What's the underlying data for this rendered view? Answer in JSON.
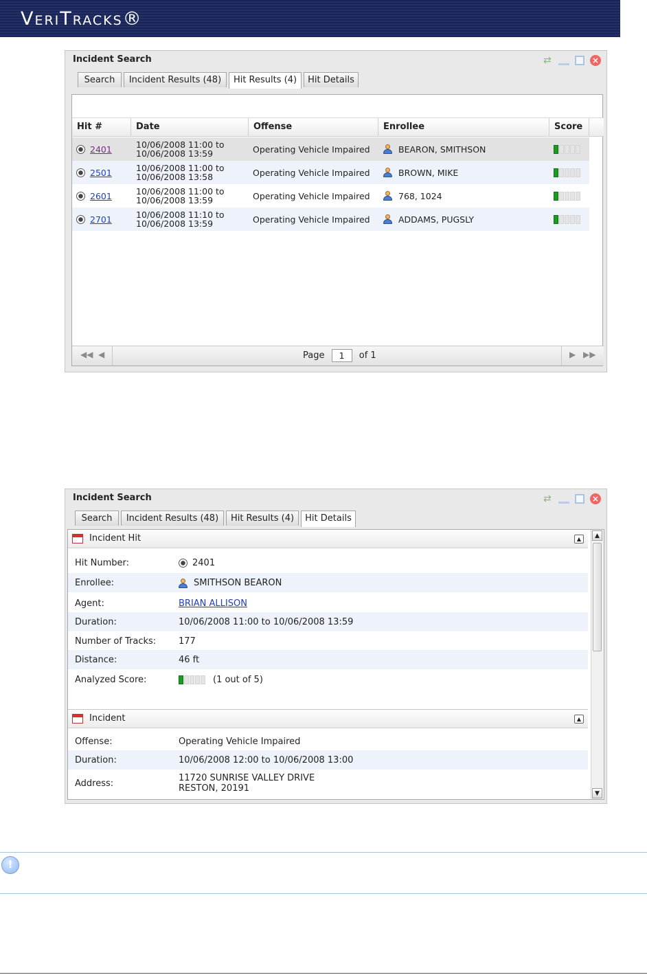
{
  "banner": {
    "logo": "VeriTracks®"
  },
  "window1": {
    "title": "Incident Search",
    "tabs": [
      "Search",
      "Incident Results (48)",
      "Hit Results (4)",
      "Hit Details"
    ],
    "columns": [
      "Hit #",
      "Date",
      "Offense",
      "Enrollee",
      "Score"
    ],
    "rows": [
      {
        "hit": "2401",
        "date_from": "10/06/2008 11:00 to",
        "date_to": "10/06/2008 13:59",
        "offense": "Operating Vehicle Impaired",
        "enrollee": "BEARON, SMITHSON",
        "score": 1
      },
      {
        "hit": "2501",
        "date_from": "10/06/2008 11:00 to",
        "date_to": "10/06/2008 13:58",
        "offense": "Operating Vehicle Impaired",
        "enrollee": "BROWN, MIKE",
        "score": 1
      },
      {
        "hit": "2601",
        "date_from": "10/06/2008 11:00 to",
        "date_to": "10/06/2008 13:59",
        "offense": "Operating Vehicle Impaired",
        "enrollee": "768, 1024",
        "score": 1
      },
      {
        "hit": "2701",
        "date_from": "10/06/2008 11:10 to",
        "date_to": "10/06/2008 13:59",
        "offense": "Operating Vehicle Impaired",
        "enrollee": "ADDAMS, PUGSLY",
        "score": 1
      }
    ],
    "pager": {
      "page_label": "Page",
      "page_value": "1",
      "of_label": "of 1"
    }
  },
  "window2": {
    "title": "Incident Search",
    "tabs": [
      "Search",
      "Incident Results (48)",
      "Hit Results (4)",
      "Hit Details"
    ],
    "hit_section": {
      "title": "Incident Hit",
      "fields": [
        {
          "label": "Hit Number:",
          "value": "2401"
        },
        {
          "label": "Enrollee:",
          "value": "SMITHSON BEARON"
        },
        {
          "label": "Agent:",
          "value": "BRIAN ALLISON"
        },
        {
          "label": "Duration:",
          "value": "10/06/2008 11:00 to 10/06/2008 13:59"
        },
        {
          "label": "Number of Tracks:",
          "value": "177"
        },
        {
          "label": "Distance:",
          "value": "46 ft"
        },
        {
          "label": "Analyzed Score:",
          "value": "(1 out of 5)"
        }
      ],
      "score": 1
    },
    "incident_section": {
      "title": "Incident",
      "fields": [
        {
          "label": "Offense:",
          "value": "Operating Vehicle Impaired"
        },
        {
          "label": "Duration:",
          "value": "10/06/2008 12:00 to 10/06/2008 13:00"
        },
        {
          "label": "Address:",
          "value_line1": "11720 SUNRISE VALLEY DRIVE",
          "value_line2": "RESTON, 20191"
        }
      ]
    }
  },
  "colors": {
    "banner": "#1a2556",
    "score_on": "#1c9a22",
    "link": "#1f3fbf",
    "visited": "#7a2a8c",
    "row_alt": "#eef2fb"
  }
}
